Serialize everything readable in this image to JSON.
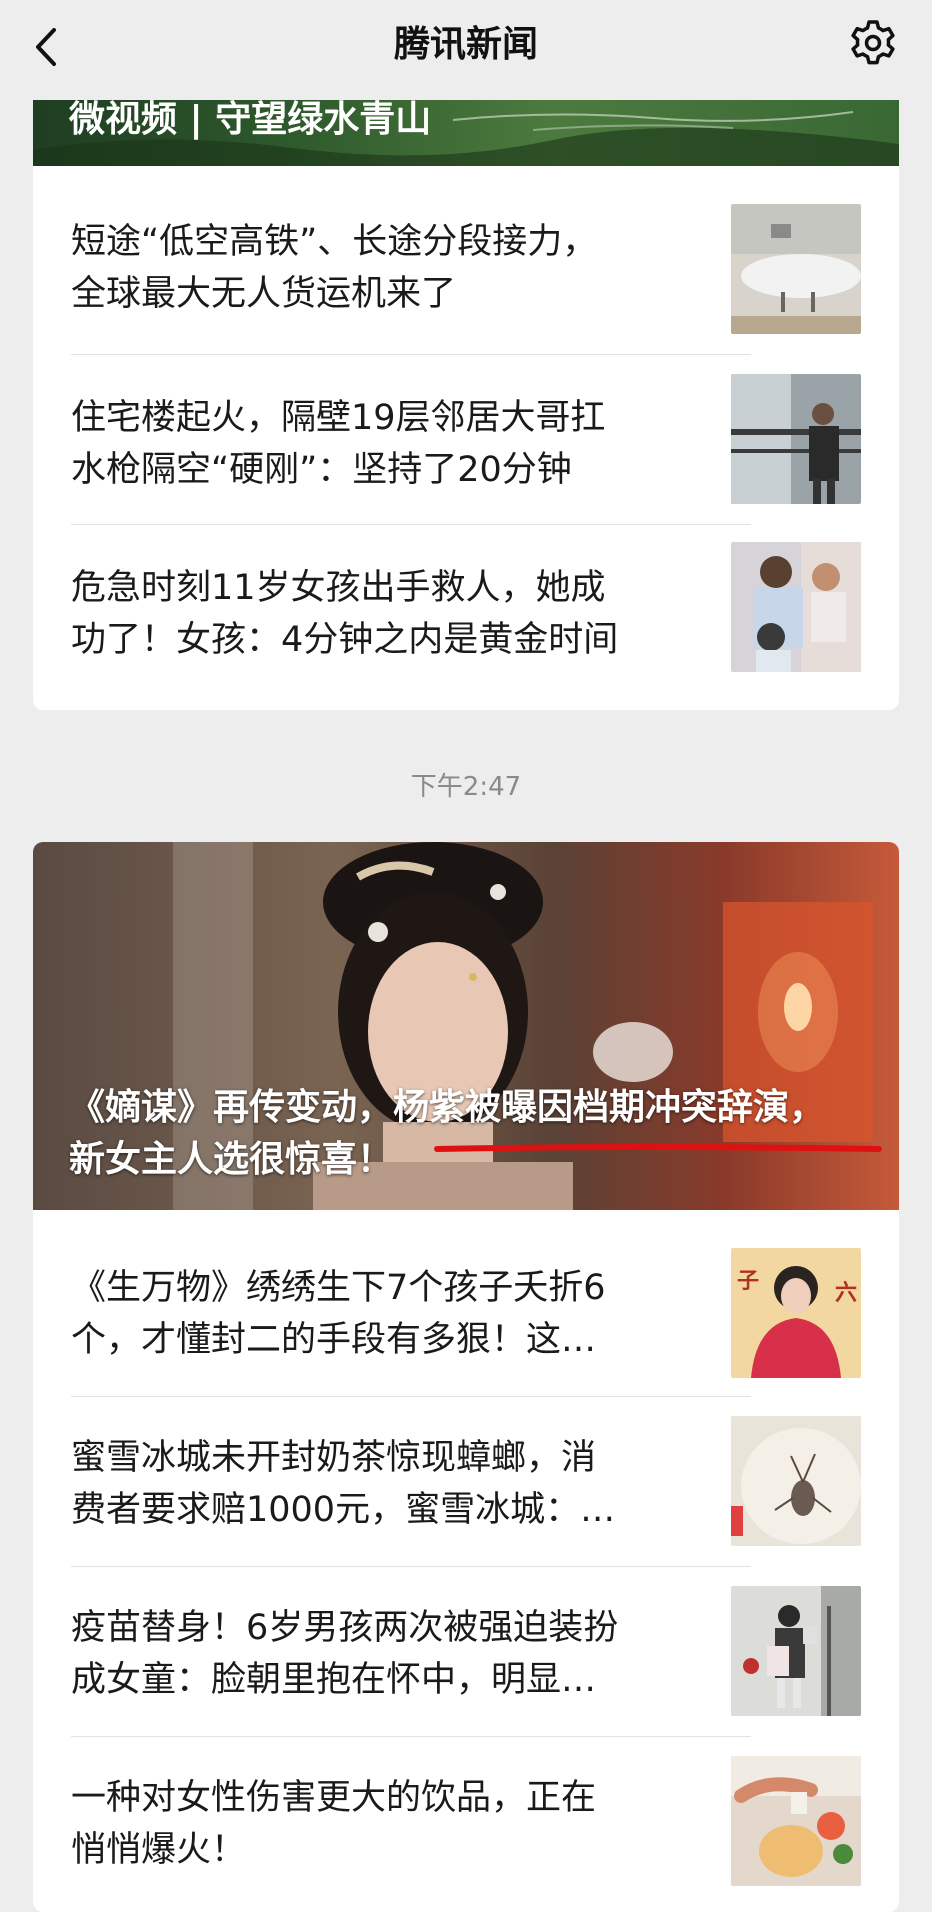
{
  "header": {
    "title": "腾讯新闻"
  },
  "card1": {
    "banner_title": "微视频 | 守望绿水青山",
    "items": [
      {
        "line1": "短途“低空高铁”、长途分段接力，",
        "line2": "全球最大无人货运机来了"
      },
      {
        "line1": "住宅楼起火，隔壁19层邻居大哥扛",
        "line2": "水枪隔空“硬刚”：坚持了20分钟"
      },
      {
        "line1": "危急时刻11岁女孩出手救人，她成",
        "line2": "功了！女孩：4分钟之内是黄金时间"
      }
    ]
  },
  "timestamp": "下午2:47",
  "card2": {
    "hero": {
      "line1": "《嫡谋》再传变动，杨紫被曝因档期冲突辞演，",
      "line2": "新女主人选很惊喜！"
    },
    "items": [
      {
        "line1": "《生万物》绣绣生下7个孩子夭折6",
        "line2": "个，才懂封二的手段有多狠！这…"
      },
      {
        "line1": "蜜雪冰城未开封奶茶惊现蟑螂，消",
        "line2": "费者要求赔1000元，蜜雪冰城：…"
      },
      {
        "line1": "疫苗替身！6岁男孩两次被强迫装扮",
        "line2": "成女童：脸朝里抱在怀中，明显…"
      },
      {
        "line1": "一种对女性伤害更大的饮品，正在",
        "line2": "悄悄爆火！"
      }
    ]
  }
}
